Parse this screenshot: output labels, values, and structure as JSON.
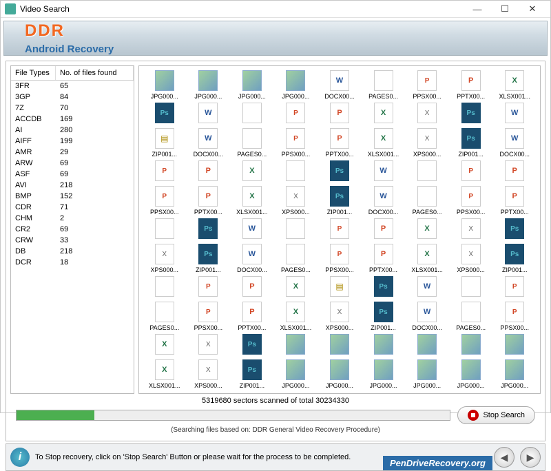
{
  "window": {
    "title": "Video Search"
  },
  "banner": {
    "brand": "DDR",
    "sub": "Android Recovery"
  },
  "types": {
    "col1": "File Types",
    "col2": "No. of files found",
    "rows": [
      {
        "t": "3FR",
        "n": "65"
      },
      {
        "t": "3GP",
        "n": "84"
      },
      {
        "t": "7Z",
        "n": "70"
      },
      {
        "t": "ACCDB",
        "n": "169"
      },
      {
        "t": "AI",
        "n": "280"
      },
      {
        "t": "AIFF",
        "n": "199"
      },
      {
        "t": "AMR",
        "n": "29"
      },
      {
        "t": "ARW",
        "n": "69"
      },
      {
        "t": "ASF",
        "n": "69"
      },
      {
        "t": "AVI",
        "n": "218"
      },
      {
        "t": "BMP",
        "n": "152"
      },
      {
        "t": "CDR",
        "n": "71"
      },
      {
        "t": "CHM",
        "n": "2"
      },
      {
        "t": "CR2",
        "n": "69"
      },
      {
        "t": "CRW",
        "n": "33"
      },
      {
        "t": "DB",
        "n": "218"
      },
      {
        "t": "DCR",
        "n": "18"
      }
    ]
  },
  "files": [
    {
      "lbl": "JPG000...",
      "ic": "jpg"
    },
    {
      "lbl": "JPG000...",
      "ic": "jpg"
    },
    {
      "lbl": "JPG000...",
      "ic": "jpg"
    },
    {
      "lbl": "JPG000...",
      "ic": "jpg"
    },
    {
      "lbl": "DOCX00...",
      "ic": "docx"
    },
    {
      "lbl": "PAGES0...",
      "ic": "pages"
    },
    {
      "lbl": "PPSX00...",
      "ic": "ppsx"
    },
    {
      "lbl": "PPTX00...",
      "ic": "pptx"
    },
    {
      "lbl": "XLSX001...",
      "ic": "xlsx"
    },
    {
      "lbl": "",
      "ic": "ps"
    },
    {
      "lbl": "",
      "ic": "docx"
    },
    {
      "lbl": "",
      "ic": "pages"
    },
    {
      "lbl": "",
      "ic": "ppsx"
    },
    {
      "lbl": "",
      "ic": "pptx"
    },
    {
      "lbl": "",
      "ic": "xlsx"
    },
    {
      "lbl": "",
      "ic": "xps"
    },
    {
      "lbl": "",
      "ic": "ps"
    },
    {
      "lbl": "",
      "ic": "docx"
    },
    {
      "lbl": "ZIP001...",
      "ic": "zip"
    },
    {
      "lbl": "DOCX00...",
      "ic": "docx"
    },
    {
      "lbl": "PAGES0...",
      "ic": "pages"
    },
    {
      "lbl": "PPSX00...",
      "ic": "ppsx"
    },
    {
      "lbl": "PPTX00...",
      "ic": "pptx"
    },
    {
      "lbl": "XLSX001...",
      "ic": "xlsx"
    },
    {
      "lbl": "XPS000...",
      "ic": "xps"
    },
    {
      "lbl": "ZIP001...",
      "ic": "ps"
    },
    {
      "lbl": "DOCX00...",
      "ic": "docx"
    },
    {
      "lbl": "",
      "ic": "ppsx"
    },
    {
      "lbl": "",
      "ic": "pptx"
    },
    {
      "lbl": "",
      "ic": "xlsx"
    },
    {
      "lbl": "",
      "ic": "pages"
    },
    {
      "lbl": "",
      "ic": "ps"
    },
    {
      "lbl": "",
      "ic": "docx"
    },
    {
      "lbl": "",
      "ic": "pages"
    },
    {
      "lbl": "",
      "ic": "ppsx"
    },
    {
      "lbl": "",
      "ic": "pptx"
    },
    {
      "lbl": "PPSX00...",
      "ic": "ppsx"
    },
    {
      "lbl": "PPTX00...",
      "ic": "pptx"
    },
    {
      "lbl": "XLSX001...",
      "ic": "xlsx"
    },
    {
      "lbl": "XPS000...",
      "ic": "xps"
    },
    {
      "lbl": "ZIP001...",
      "ic": "ps"
    },
    {
      "lbl": "DOCX00...",
      "ic": "docx"
    },
    {
      "lbl": "PAGES0...",
      "ic": "pages"
    },
    {
      "lbl": "PPSX00...",
      "ic": "ppsx"
    },
    {
      "lbl": "PPTX00...",
      "ic": "pptx"
    },
    {
      "lbl": "",
      "ic": "pages"
    },
    {
      "lbl": "",
      "ic": "ps"
    },
    {
      "lbl": "",
      "ic": "docx"
    },
    {
      "lbl": "",
      "ic": "pages"
    },
    {
      "lbl": "",
      "ic": "ppsx"
    },
    {
      "lbl": "",
      "ic": "pptx"
    },
    {
      "lbl": "",
      "ic": "xlsx"
    },
    {
      "lbl": "",
      "ic": "xps"
    },
    {
      "lbl": "",
      "ic": "ps"
    },
    {
      "lbl": "XPS000...",
      "ic": "xps"
    },
    {
      "lbl": "ZIP001...",
      "ic": "ps"
    },
    {
      "lbl": "DOCX00...",
      "ic": "docx"
    },
    {
      "lbl": "PAGES0...",
      "ic": "pages"
    },
    {
      "lbl": "PPSX00...",
      "ic": "ppsx"
    },
    {
      "lbl": "PPTX00...",
      "ic": "pptx"
    },
    {
      "lbl": "XLSX001...",
      "ic": "xlsx"
    },
    {
      "lbl": "XPS000...",
      "ic": "xps"
    },
    {
      "lbl": "ZIP001...",
      "ic": "ps"
    },
    {
      "lbl": "",
      "ic": "pages"
    },
    {
      "lbl": "",
      "ic": "ppsx"
    },
    {
      "lbl": "",
      "ic": "pptx"
    },
    {
      "lbl": "",
      "ic": "xlsx"
    },
    {
      "lbl": "",
      "ic": "zip"
    },
    {
      "lbl": "",
      "ic": "ps"
    },
    {
      "lbl": "",
      "ic": "docx"
    },
    {
      "lbl": "",
      "ic": "pages"
    },
    {
      "lbl": "",
      "ic": "ppsx"
    },
    {
      "lbl": "PAGES0...",
      "ic": "pages"
    },
    {
      "lbl": "PPSX00...",
      "ic": "ppsx"
    },
    {
      "lbl": "PPTX00...",
      "ic": "pptx"
    },
    {
      "lbl": "XLSX001...",
      "ic": "xlsx"
    },
    {
      "lbl": "XPS000...",
      "ic": "xps"
    },
    {
      "lbl": "ZIP001...",
      "ic": "ps"
    },
    {
      "lbl": "DOCX00...",
      "ic": "docx"
    },
    {
      "lbl": "PAGES0...",
      "ic": "pages"
    },
    {
      "lbl": "PPSX00...",
      "ic": "ppsx"
    },
    {
      "lbl": "",
      "ic": "xlsx"
    },
    {
      "lbl": "",
      "ic": "xps"
    },
    {
      "lbl": "",
      "ic": "ps"
    },
    {
      "lbl": "",
      "ic": "jpg"
    },
    {
      "lbl": "",
      "ic": "jpg"
    },
    {
      "lbl": "",
      "ic": "jpg"
    },
    {
      "lbl": "",
      "ic": "jpg"
    },
    {
      "lbl": "",
      "ic": "jpg"
    },
    {
      "lbl": "",
      "ic": "jpg"
    },
    {
      "lbl": "XLSX001...",
      "ic": "xlsx"
    },
    {
      "lbl": "XPS000...",
      "ic": "xps"
    },
    {
      "lbl": "ZIP001...",
      "ic": "ps"
    },
    {
      "lbl": "JPG000...",
      "ic": "jpg"
    },
    {
      "lbl": "JPG000...",
      "ic": "jpg"
    },
    {
      "lbl": "JPG000...",
      "ic": "jpg"
    },
    {
      "lbl": "JPG000...",
      "ic": "jpg"
    },
    {
      "lbl": "JPG000...",
      "ic": "jpg"
    },
    {
      "lbl": "JPG000...",
      "ic": "jpg"
    }
  ],
  "progress": {
    "text": "5319680 sectors scanned of total 30234330",
    "sub": "(Searching files based on:  DDR General Video Recovery Procedure)",
    "stop_label": "Stop Search",
    "percent": 18
  },
  "footer": {
    "text": "To Stop recovery, click on 'Stop Search' Button or please wait for the process to be completed.",
    "promo": "PenDriveRecovery.org"
  }
}
